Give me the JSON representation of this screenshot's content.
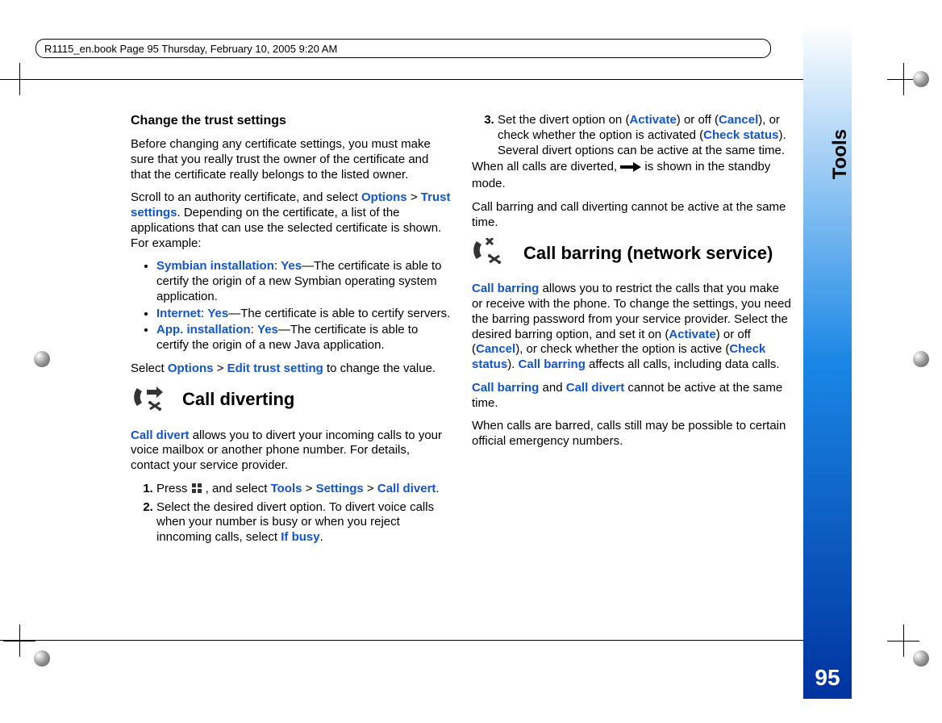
{
  "header": "R1115_en.book  Page 95  Thursday, February 10, 2005  9:20 AM",
  "side_tab": "Tools",
  "page_number": "95",
  "h_trust": "Change the trust settings",
  "p_trust_intro": "Before changing any certificate settings, you must make sure that you really trust the owner of the certificate and that the certificate really belongs to the listed owner.",
  "p_scroll_1": "Scroll to an authority certificate, and select ",
  "w_options": "Options",
  "gt": " > ",
  "w_trust_settings": "Trust settings",
  "p_scroll_2": ". Depending on the certificate, a list of the applications that can use the selected certificate is shown. For example:",
  "bul_sym_k": "Symbian installation",
  "colon": ": ",
  "w_yes": "Yes",
  "bul_sym_t": "—The certificate is able to certify the origin of a new Symbian operating system application.",
  "bul_int_k": "Internet",
  "bul_int_t": "—The certificate is able to certify servers.",
  "bul_app_k": "App. installation",
  "bul_app_t": "—The certificate is able to certify the origin of a new Java application.",
  "p_select_1": "Select ",
  "w_edit_trust": "Edit trust setting",
  "p_select_2": " to change the value.",
  "h_divert": "Call diverting",
  "w_call_divert": "Call divert",
  "p_divert_intro": " allows you to divert your incoming calls to your voice mailbox or another phone number. For details, contact your service provider.",
  "step1_a": "Press ",
  "step1_b": " , and select ",
  "w_tools": "Tools",
  "w_settings": "Settings",
  "step1_end": ".",
  "step2_a": "Select the desired divert option. To divert voice calls when your number is busy or when you reject inncoming calls, select ",
  "w_if_busy": "If busy",
  "step3_a": "Set the divert option on (",
  "w_activate": "Activate",
  "step3_b": ") or off (",
  "w_cancel": "Cancel",
  "step3_c": "), or check whether the option is activated (",
  "w_check_status": "Check status",
  "step3_d": "). Several divert options can be active at the same time.",
  "p_when_all_1": "When all calls are diverted, ",
  "p_when_all_2": " is shown in the standby mode.",
  "p_bar_div": "Call barring and call diverting cannot be active at the same time.",
  "h_barring": "Call barring (network service)",
  "w_call_barring": "Call barring",
  "p_bar_intro": " allows you to restrict the calls that you make or receive with the phone. To change the settings, you need the barring password from your service provider. Select the desired barring option, and set it on (",
  "p_bar_intro2": ") or off (",
  "p_bar_intro3": "), or check whether the option is active (",
  "p_bar_intro4": "). ",
  "p_bar_intro5": " affects all calls, including data calls.",
  "p_bar_same_1": " and ",
  "p_bar_same_2": " cannot be active at the same time.",
  "p_bar_emerg": "When calls are barred, calls still may be possible to certain official emergency numbers."
}
